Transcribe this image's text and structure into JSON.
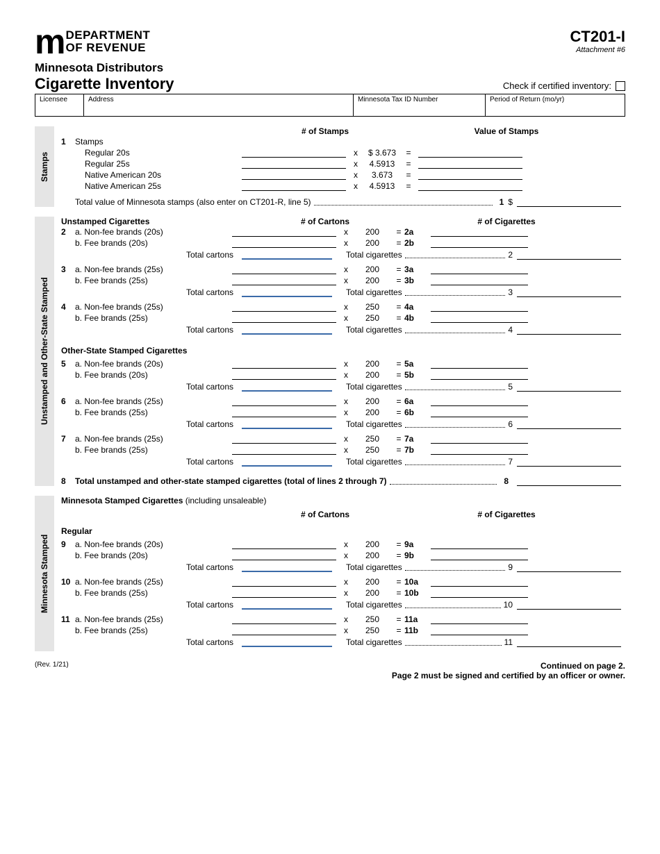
{
  "header": {
    "dept_line1": "DEPARTMENT",
    "dept_line2": "OF REVENUE",
    "form_code": "CT201-I",
    "attachment": "Attachment #6",
    "title_line1": "Minnesota Distributors",
    "title_line2": "Cigarette Inventory",
    "certified_label": "Check if certified inventory:"
  },
  "info": {
    "licensee": "Licensee",
    "address": "Address",
    "taxid": "Minnesota Tax ID Number",
    "period": "Period of Return (mo/yr)"
  },
  "stamps": {
    "section_label": "Stamps",
    "col_mid": "# of Stamps",
    "col_right": "Value of Stamps",
    "head": "Stamps",
    "rows": [
      {
        "label": "Regular 20s",
        "rate": "$ 3.673"
      },
      {
        "label": "Regular 25s",
        "rate": "4.5913"
      },
      {
        "label": "Native American 20s",
        "rate": "3.673"
      },
      {
        "label": "Native American 25s",
        "rate": "4.5913"
      }
    ],
    "total_text": "Total value of Minnesota stamps (also enter on CT201-R, line 5)",
    "total_num": "1",
    "total_sym": "$"
  },
  "unstamped": {
    "section_label": "Unstamped and Other-State Stamped",
    "head1": "Unstamped Cigarettes",
    "col_mid": "# of Cartons",
    "col_right": "# of Cigarettes",
    "groups": [
      {
        "num": "2",
        "a": "a. Non-fee brands (20s)",
        "b": "b. Fee brands (20s)",
        "rate": "200",
        "ra": "2a",
        "rb": "2b",
        "tnum": "2"
      },
      {
        "num": "3",
        "a": "a. Non-fee brands (25s)",
        "b": "b. Fee brands (25s)",
        "rate": "200",
        "ra": "3a",
        "rb": "3b",
        "tnum": "3"
      },
      {
        "num": "4",
        "a": "a. Non-fee brands (25s)",
        "b": "b. Fee brands (25s)",
        "rate": "250",
        "ra": "4a",
        "rb": "4b",
        "tnum": "4"
      }
    ],
    "head2": "Other-State Stamped Cigarettes",
    "groups2": [
      {
        "num": "5",
        "a": "a. Non-fee brands (20s)",
        "b": "b. Fee brands (20s)",
        "rate": "200",
        "ra": "5a",
        "rb": "5b",
        "tnum": "5"
      },
      {
        "num": "6",
        "a": "a. Non-fee brands (25s)",
        "b": "b. Fee brands (25s)",
        "rate": "200",
        "ra": "6a",
        "rb": "6b",
        "tnum": "6"
      },
      {
        "num": "7",
        "a": "a. Non-fee brands (25s)",
        "b": "b. Fee brands (25s)",
        "rate": "250",
        "ra": "7a",
        "rb": "7b",
        "tnum": "7"
      }
    ],
    "total_cartons": "Total cartons",
    "total_cigs": "Total cigarettes",
    "line8_num": "8",
    "line8_text": "Total unstamped and other-state stamped cigarettes (total of lines 2 through 7)",
    "line8_end": "8"
  },
  "mn_stamped": {
    "section_label": "Minnesota Stamped",
    "head": "Minnesota Stamped Cigarettes",
    "head_paren": " (including unsaleable)",
    "col_mid": "# of Cartons",
    "col_right": "# of Cigarettes",
    "sub_head": "Regular",
    "groups": [
      {
        "num": "9",
        "a": "a. Non-fee brands (20s)",
        "b": "b. Fee brands (20s)",
        "rate": "200",
        "ra": "9a",
        "rb": "9b",
        "tnum": "9"
      },
      {
        "num": "10",
        "a": "a. Non-fee brands (25s)",
        "b": "b. Fee brands (25s)",
        "rate": "200",
        "ra": "10a",
        "rb": "10b",
        "tnum": "10"
      },
      {
        "num": "11",
        "a": "a. Non-fee brands (25s)",
        "b": "b. Fee brands (25s)",
        "rate": "250",
        "ra": "11a",
        "rb": "11b",
        "tnum": "11"
      }
    ],
    "total_cartons": "Total cartons",
    "total_cigs": "Total cigarettes"
  },
  "footer": {
    "rev": "(Rev. 1/21)",
    "cont": "Continued on page 2.",
    "note": "Page 2 must be signed and certified by an officer or owner."
  }
}
